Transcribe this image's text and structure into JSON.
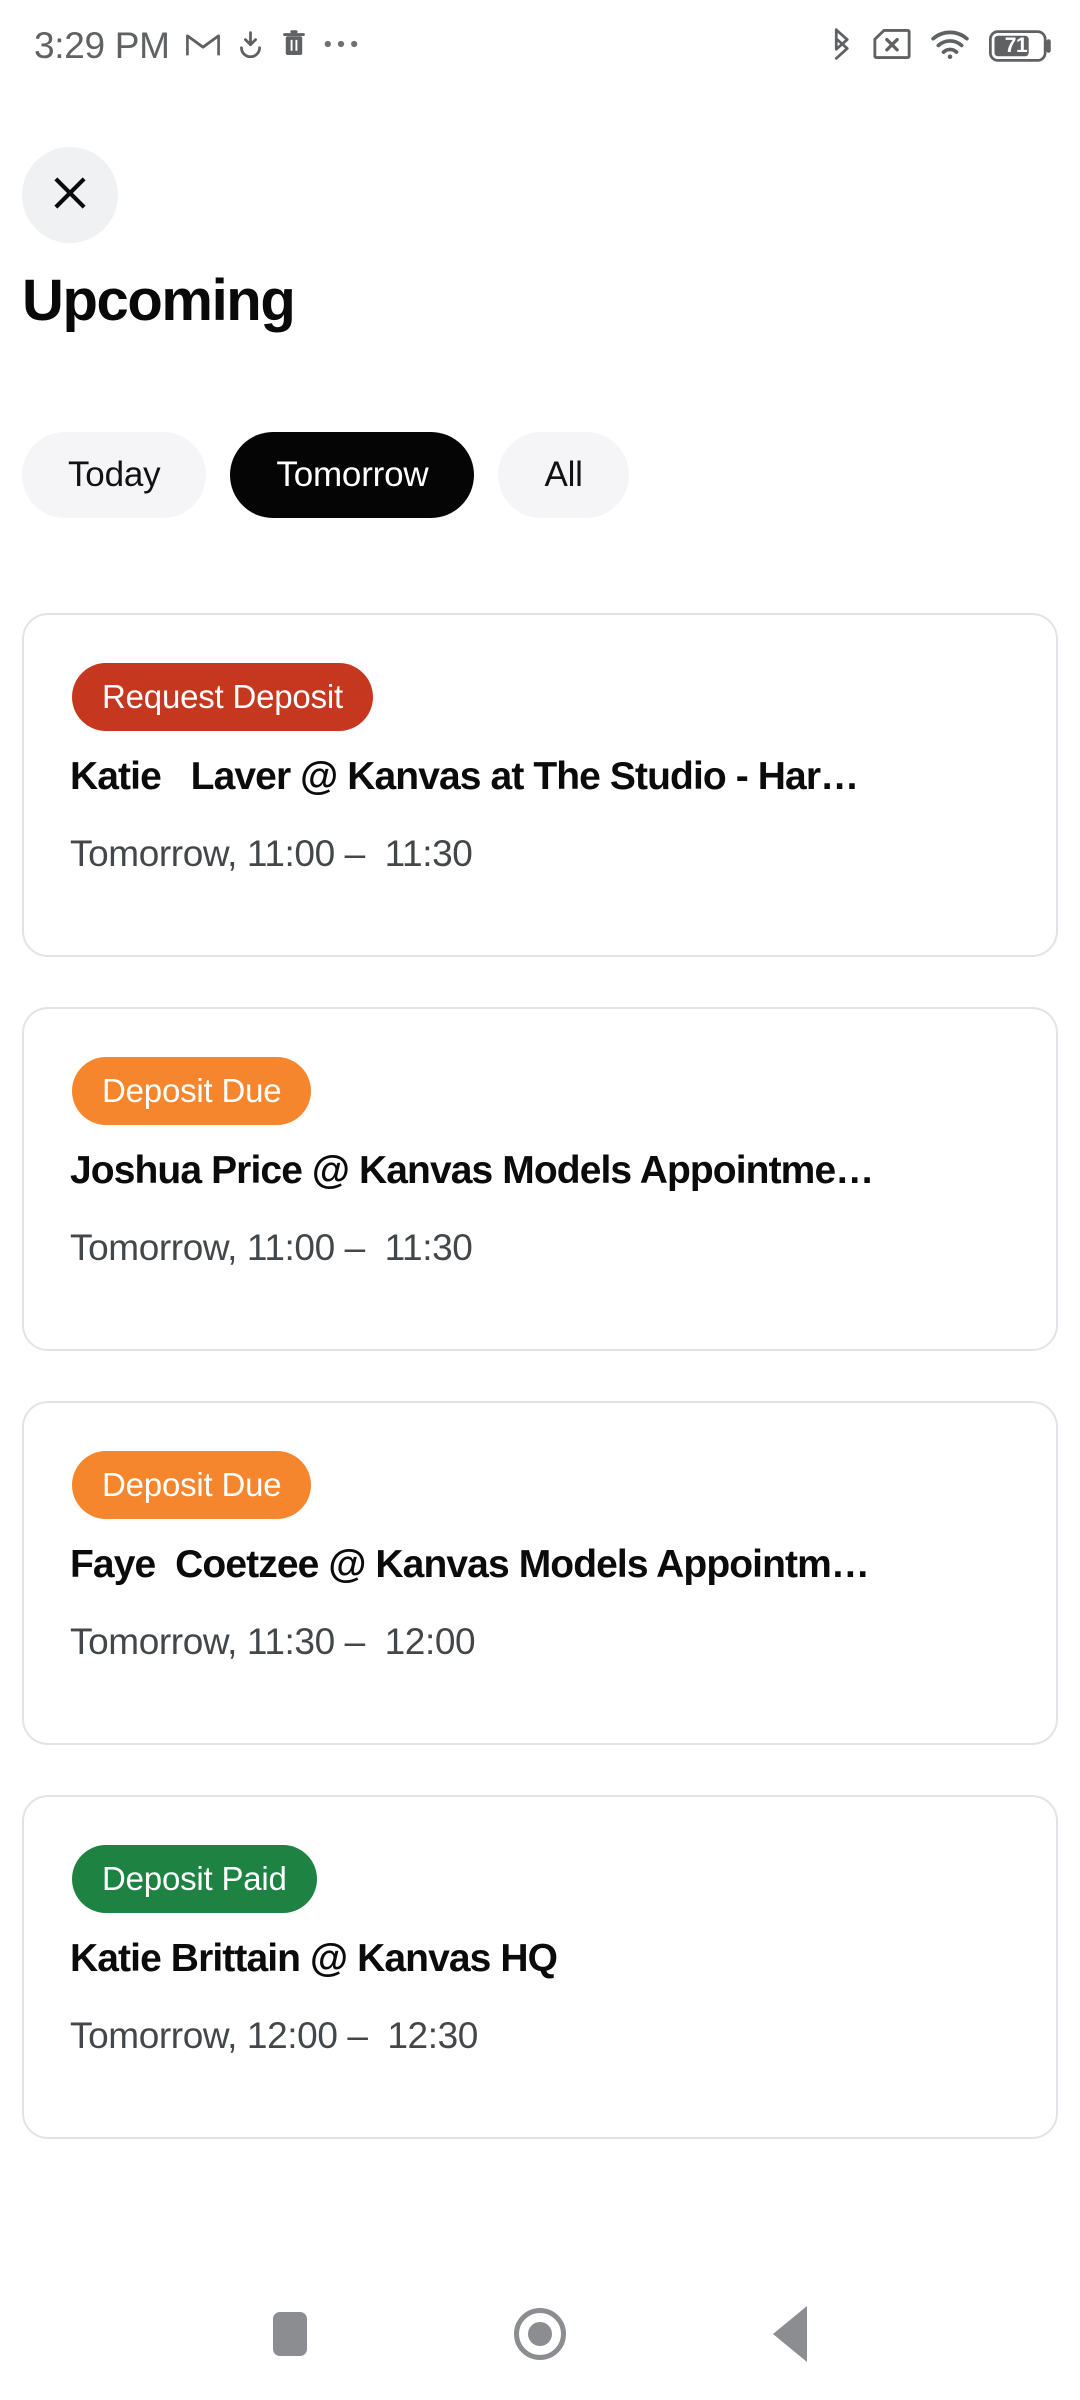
{
  "status_bar": {
    "clock": "3:29 PM",
    "left_icons": [
      "gmail-icon",
      "download-icon",
      "trash-icon",
      "overflow-dots-icon"
    ],
    "right_icons": [
      "bluetooth-icon",
      "sim-card-off-icon",
      "wifi-icon",
      "battery-icon"
    ],
    "battery_level": "71"
  },
  "header": {
    "close_icon": "close-icon",
    "title": "Upcoming"
  },
  "filters": {
    "items": [
      {
        "label": "Today",
        "selected": false
      },
      {
        "label": "Tomorrow",
        "selected": true
      },
      {
        "label": "All",
        "selected": false
      }
    ]
  },
  "colors": {
    "badge_request_deposit": "#c5381f",
    "badge_deposit_due": "#f5862d",
    "badge_deposit_paid": "#1e8243",
    "pill_active_bg": "#050505",
    "pill_inactive_bg": "#f5f5f8",
    "card_border": "#e2e3e6",
    "title_text": "#090909",
    "time_text": "#44474a"
  },
  "cards": [
    {
      "badge": "Request Deposit",
      "badge_color": "#c5381f",
      "title": "Katie   Laver @ Kanvas at The Studio - Har…",
      "time": "Tomorrow, 11:00 –  11:30"
    },
    {
      "badge": "Deposit Due",
      "badge_color": "#f5862d",
      "title": "Joshua Price @ Kanvas Models Appointme…",
      "time": "Tomorrow, 11:00 –  11:30"
    },
    {
      "badge": "Deposit Due",
      "badge_color": "#f5862d",
      "title": "Faye  Coetzee @ Kanvas Models Appointm…",
      "time": "Tomorrow, 11:30 –  12:00"
    },
    {
      "badge": "Deposit Paid",
      "badge_color": "#1e8243",
      "title": "Katie Brittain @ Kanvas HQ",
      "time": "Tomorrow, 12:00 –  12:30"
    }
  ],
  "nav_bar": {
    "recents_icon": "square-recents-icon",
    "home_icon": "circle-home-icon",
    "back_icon": "triangle-back-icon"
  }
}
